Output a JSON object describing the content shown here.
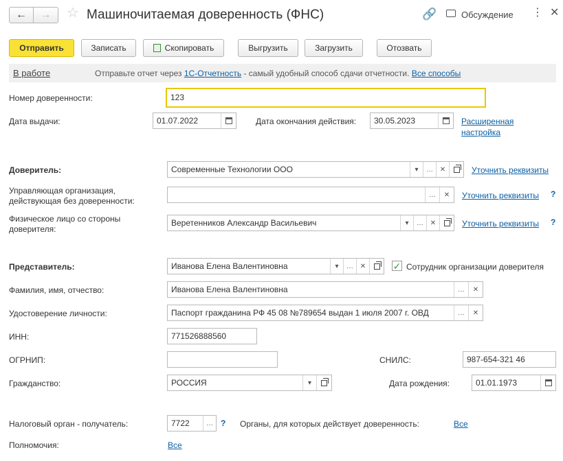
{
  "window": {
    "title": "Машиночитаемая доверенность (ФНС)",
    "discussion_label": "Обсуждение"
  },
  "toolbar": {
    "send": "Отправить",
    "save": "Записать",
    "copy": "Скопировать",
    "export": "Выгрузить",
    "import": "Загрузить",
    "revoke": "Отозвать"
  },
  "info": {
    "status": "В работе",
    "text_before": "Отправьте отчет через",
    "service_link": "1С-Отчетность",
    "text_after": "- самый удобный способ сдачи отчетности.",
    "all_methods_link": "Все способы"
  },
  "form": {
    "number_label": "Номер доверенности:",
    "number_value": "123",
    "issue_date_label": "Дата выдачи:",
    "issue_date_value": "01.07.2022",
    "end_date_label": "Дата окончания действия:",
    "end_date_value": "30.05.2023",
    "advanced_link_line1": "Расширенная",
    "advanced_link_line2": "настройка",
    "principal_label": "Доверитель:",
    "principal_value": "Современные Технологии ООО",
    "clarify_link": "Уточнить реквизиты",
    "managing_org_label_line1": "Управляющая организация,",
    "managing_org_label_line2": "действующая без доверенности:",
    "managing_org_value": "",
    "individual_label_line1": "Физическое лицо со стороны",
    "individual_label_line2": "доверителя:",
    "individual_value": "Веретенников Александр Васильевич",
    "question_mark": "?",
    "representative_label": "Представитель:",
    "representative_value": "Иванова Елена Валентиновна",
    "employee_checkbox_label": "Сотрудник организации доверителя",
    "fio_label": "Фамилия, имя, отчество:",
    "fio_value": "Иванова Елена Валентиновна",
    "id_doc_label": "Удостоверение личности:",
    "id_doc_value": "Паспорт гражданина РФ 45 08 №789654 выдан 1 июля 2007 г. ОВД",
    "inn_label": "ИНН:",
    "inn_value": "771526888560",
    "ogrnip_label": "ОГРНИП:",
    "ogrnip_value": "",
    "snils_label": "СНИЛС:",
    "snils_value": "987-654-321 46",
    "citizenship_label": "Гражданство:",
    "citizenship_value": "РОССИЯ",
    "birth_date_label": "Дата рождения:",
    "birth_date_value": "01.01.1973",
    "tax_authority_label": "Налоговый орган - получатель:",
    "tax_authority_value": "7722",
    "authorities_label": "Органы, для которых действует доверенность:",
    "authorities_link": "Все",
    "powers_label": "Полномочия:",
    "powers_link": "Все"
  },
  "colors": {
    "accent_button": "#f9e135",
    "link": "#0b5fa5",
    "focused_border": "#e8c800",
    "checkbox": "#3a9a3a"
  }
}
